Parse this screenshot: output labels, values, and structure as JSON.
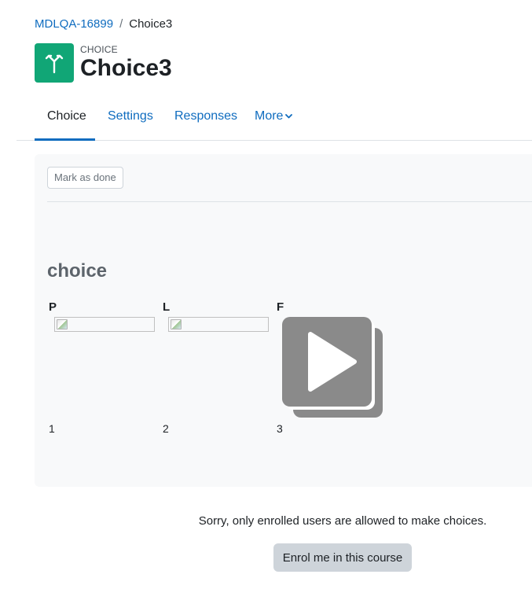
{
  "breadcrumb": {
    "course": "MDLQA-16899",
    "separator": "/",
    "current": "Choice3"
  },
  "header": {
    "pretitle": "CHOICE",
    "title": "Choice3",
    "icon": "choice-signpost-icon",
    "icon_color": "#11a676"
  },
  "tabs": [
    {
      "label": "Choice",
      "active": true
    },
    {
      "label": "Settings",
      "active": false
    },
    {
      "label": "Responses",
      "active": false
    },
    {
      "label": "More",
      "active": false,
      "icon": "chevron-down-icon"
    }
  ],
  "activity": {
    "mark_done_label": "Mark as done",
    "heading": "choice",
    "options": [
      {
        "label": "P",
        "number": "1"
      },
      {
        "label": "L",
        "number": "2"
      },
      {
        "label": "F",
        "number": "3"
      }
    ]
  },
  "video_overlay": {
    "icon": "play-icon"
  },
  "footer": {
    "notice": "Sorry, only enrolled users are allowed to make choices.",
    "enrol_label": "Enrol me in this course"
  },
  "colors": {
    "link": "#0f6cbf",
    "panel_bg": "#f8f9fa",
    "enrol_button_bg": "#ced4da",
    "play_icon": "#8a8a8a"
  }
}
